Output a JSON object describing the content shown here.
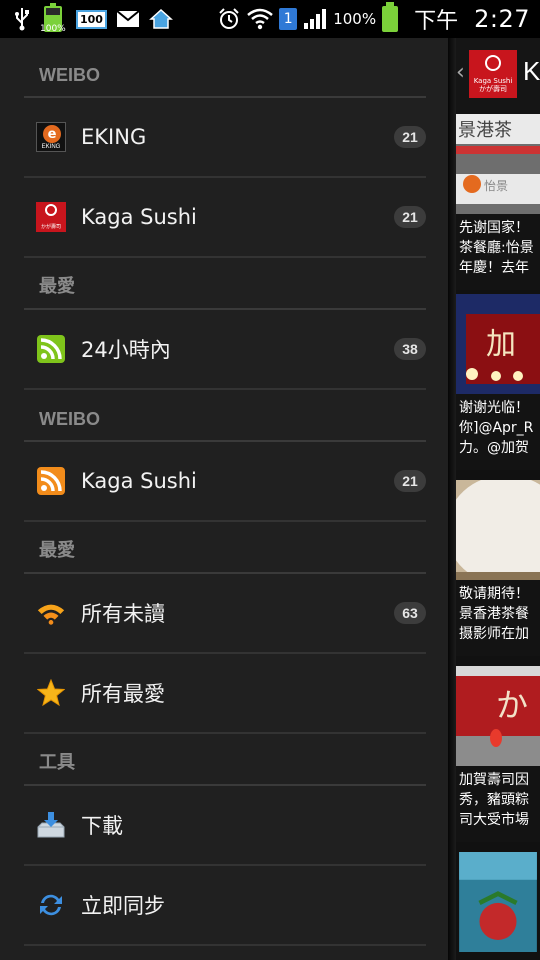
{
  "status_bar": {
    "battery_small_pct": "100%",
    "box_100": "100",
    "sim_number": "1",
    "battery_pct": "100%",
    "ampm": "下午",
    "time": "2:27"
  },
  "drawer": {
    "sections": [
      {
        "header": "WEIBO",
        "items": [
          {
            "label": "EKING",
            "badge": "21",
            "icon": "eking-logo-icon"
          },
          {
            "label": "Kaga Sushi",
            "badge": "21",
            "icon": "kaga-sushi-logo-icon"
          }
        ]
      },
      {
        "header": "最愛",
        "items": [
          {
            "label": "24小時內",
            "badge": "38",
            "icon": "rss-green-icon"
          }
        ]
      },
      {
        "header": "WEIBO",
        "items": [
          {
            "label": "Kaga Sushi",
            "badge": "21",
            "icon": "rss-orange-icon"
          }
        ]
      },
      {
        "header": "最愛",
        "items": [
          {
            "label": "所有未讀",
            "badge": "63",
            "icon": "unread-feed-icon"
          },
          {
            "label": "所有最愛",
            "badge": "",
            "icon": "star-icon"
          }
        ]
      },
      {
        "header": "工具",
        "items": [
          {
            "label": "下載",
            "badge": "",
            "icon": "download-icon"
          },
          {
            "label": "立即同步",
            "badge": "",
            "icon": "sync-icon"
          }
        ]
      }
    ]
  },
  "pane": {
    "title": "K",
    "logo_text": "Kaga Sushi かが壽司",
    "cards": [
      {
        "lines": [
          "先谢国家！",
          "茶餐廳:怡景",
          "年慶！去年"
        ]
      },
      {
        "lines": [
          "谢谢光临！",
          "你]@Apr_R",
          "力。@加贺"
        ]
      },
      {
        "lines": [
          "敬请期待！",
          "景香港茶餐",
          "摄影师在加"
        ]
      },
      {
        "lines": [
          "加賀壽司因",
          "秀，豬頭粽",
          "司大受市場"
        ]
      }
    ]
  },
  "colors": {
    "drawer_bg": "#202020",
    "divider": "#3a3a3a",
    "header_text": "#8a8a8a",
    "badge_bg": "#3c3c3c",
    "kaga_red": "#c8151d",
    "rss_green": "#7fc41b",
    "rss_orange": "#f28c1b"
  }
}
